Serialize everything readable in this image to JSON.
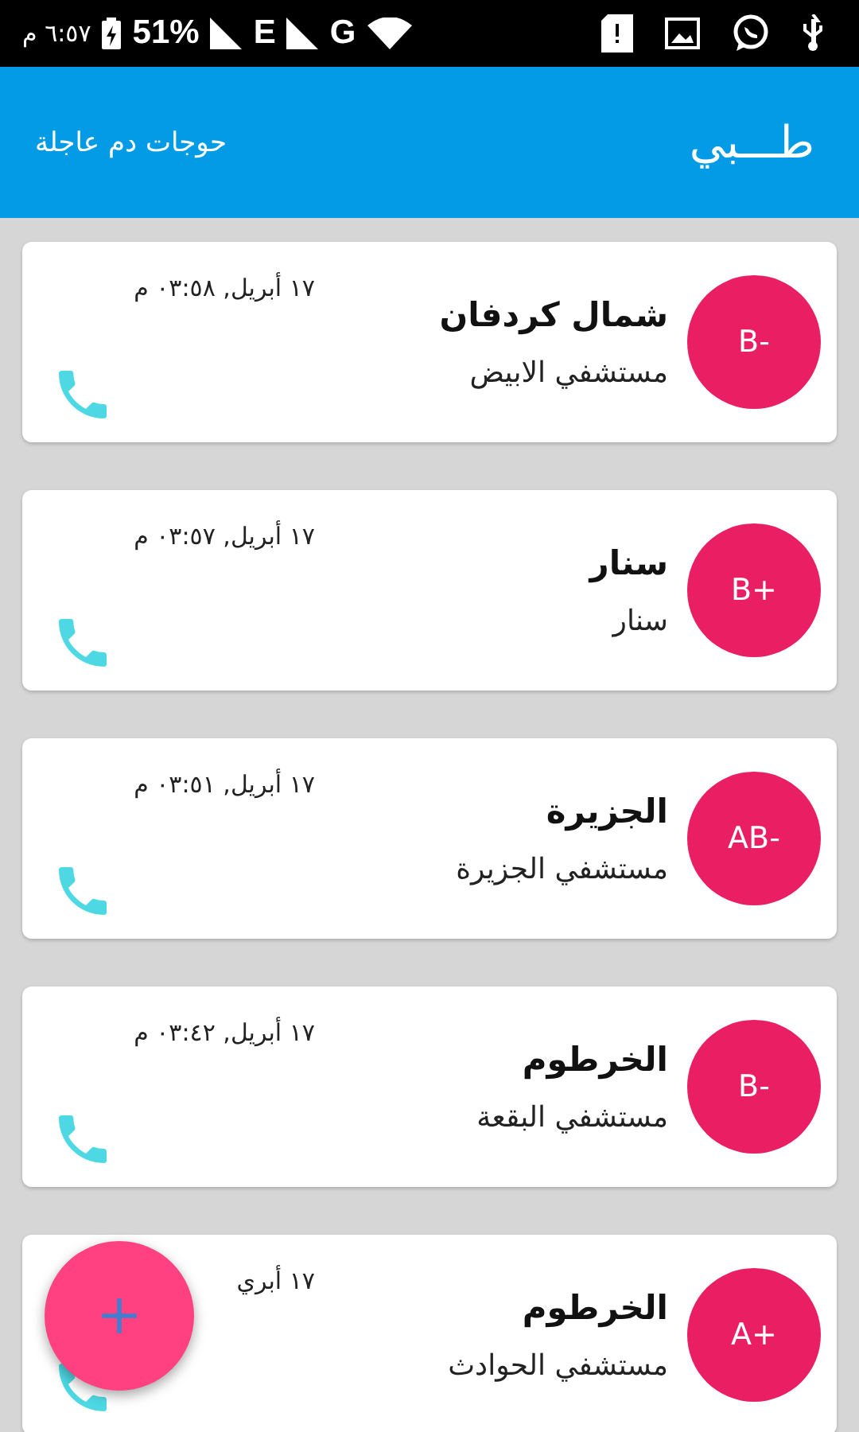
{
  "status_bar": {
    "time": "٦:٥٧ م",
    "battery": "51%",
    "network_1": "E",
    "network_2": "G"
  },
  "app_bar": {
    "title": "طـــبي",
    "subtitle": "حوجات دم عاجلة"
  },
  "requests": [
    {
      "blood_type": "B-",
      "region": "شمال كردفان",
      "hospital": "مستشفي الابيض",
      "date": "١٧ أبريل, ٠٣:٥٨ م"
    },
    {
      "blood_type": "B+",
      "region": "سنار",
      "hospital": "سنار",
      "date": "١٧ أبريل, ٠٣:٥٧ م"
    },
    {
      "blood_type": "AB-",
      "region": "الجزيرة",
      "hospital": "مستشفي الجزيرة",
      "date": "١٧ أبريل, ٠٣:٥١ م"
    },
    {
      "blood_type": "B-",
      "region": "الخرطوم",
      "hospital": "مستشفي البقعة",
      "date": "١٧ أبريل, ٠٣:٤٢ م"
    },
    {
      "blood_type": "A+",
      "region": "الخرطوم",
      "hospital": "مستشفي الحوادث",
      "date": "١٧ أبري"
    }
  ]
}
